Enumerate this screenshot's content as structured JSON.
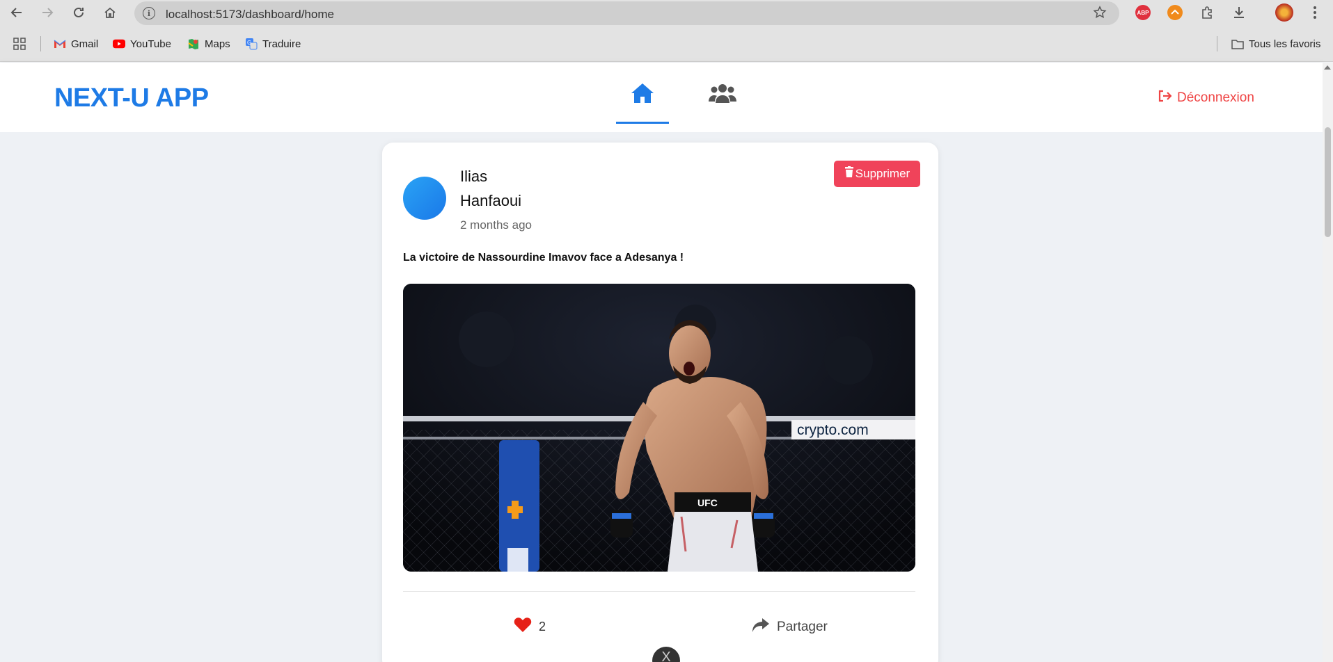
{
  "browser": {
    "url": "localhost:5173/dashboard/home",
    "bookmarks": [
      {
        "label": "Gmail",
        "icon": "gmail-icon"
      },
      {
        "label": "YouTube",
        "icon": "youtube-icon"
      },
      {
        "label": "Maps",
        "icon": "maps-icon"
      },
      {
        "label": "Traduire",
        "icon": "translate-icon"
      }
    ],
    "all_bookmarks": "Tous les favoris",
    "extension_abp": "ABP"
  },
  "header": {
    "logo": "NEXT-U APP",
    "logout_label": "Déconnexion",
    "accent_color": "#1e7be6",
    "logout_color": "#ef4444"
  },
  "post": {
    "first_name": "Ilias",
    "last_name": "Hanfaoui",
    "time": "2 months ago",
    "delete_label": "Supprimer",
    "text": "La victoire de Nassourdine Imavov face a Adesanya !",
    "image_banner": "crypto.com",
    "image_shorts": "UFC",
    "likes": "2",
    "share_label": "Partager"
  },
  "float_button": "X"
}
